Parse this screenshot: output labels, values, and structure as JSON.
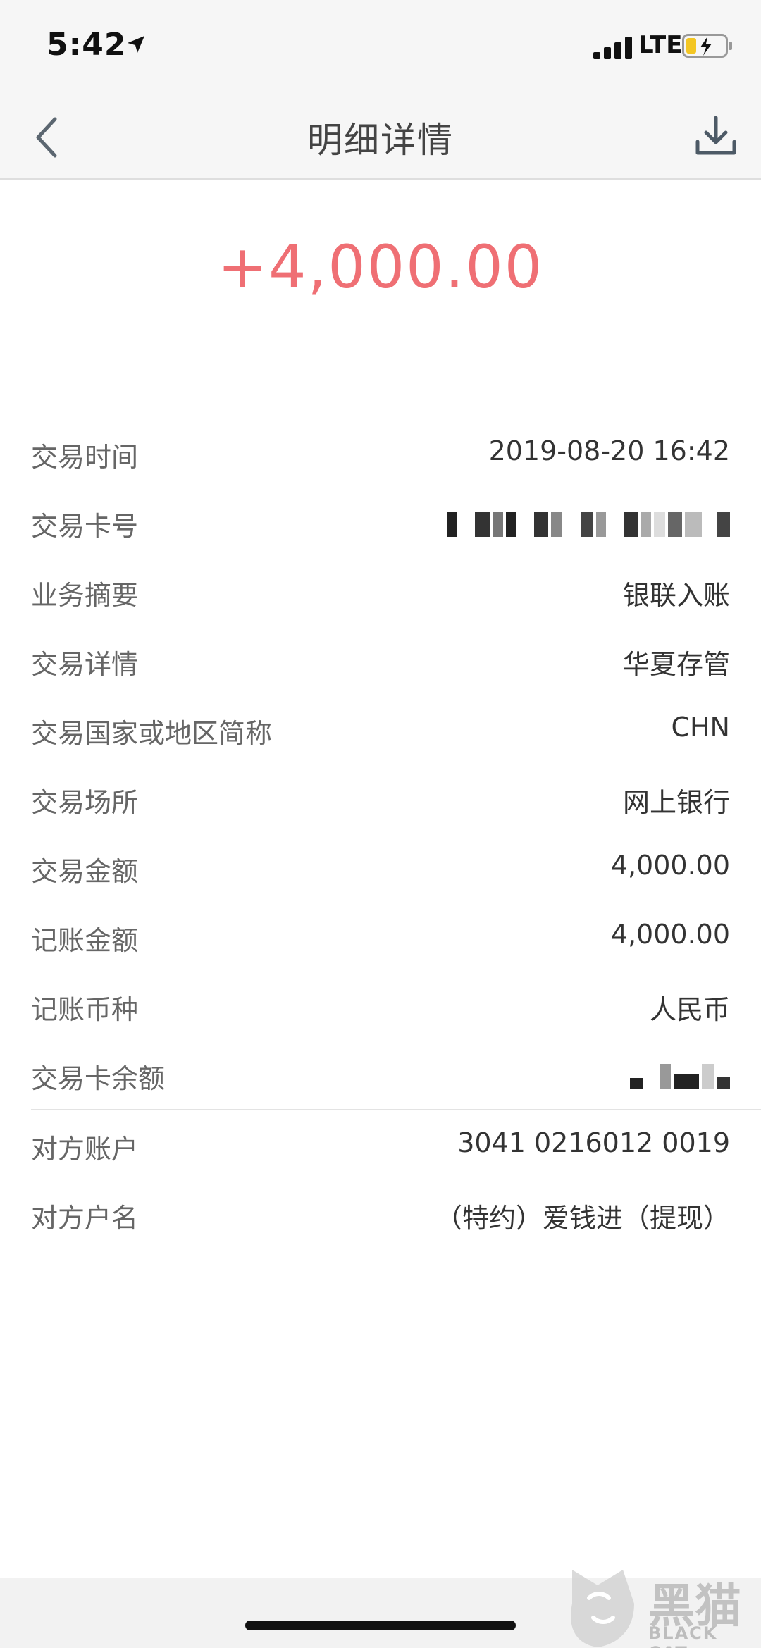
{
  "status_bar": {
    "time": "5:42",
    "network": "LTE"
  },
  "nav": {
    "title": "明细详情"
  },
  "amount": "+4,000.00",
  "details": [
    {
      "label": "交易时间",
      "value": "2019-08-20 16:42"
    },
    {
      "label": "交易卡号",
      "value": ""
    },
    {
      "label": "业务摘要",
      "value": "银联入账"
    },
    {
      "label": "交易详情",
      "value": "华夏存管"
    },
    {
      "label": "交易国家或地区简称",
      "value": "CHN"
    },
    {
      "label": "交易场所",
      "value": "网上银行"
    },
    {
      "label": "交易金额",
      "value": "4,000.00"
    },
    {
      "label": "记账金额",
      "value": "4,000.00"
    },
    {
      "label": "记账币种",
      "value": "人民币"
    },
    {
      "label": "交易卡余额",
      "value": ""
    }
  ],
  "counterparty": [
    {
      "label": "对方账户",
      "value": "3041 0216012 0019"
    },
    {
      "label": "对方户名",
      "value": "（特约）爱钱进（提现）"
    }
  ],
  "watermark": {
    "text": "黑猫",
    "sub": "BLACK CAT"
  },
  "colors": {
    "amount": "#ef6f74",
    "nav_background": "#f6f6f6"
  }
}
